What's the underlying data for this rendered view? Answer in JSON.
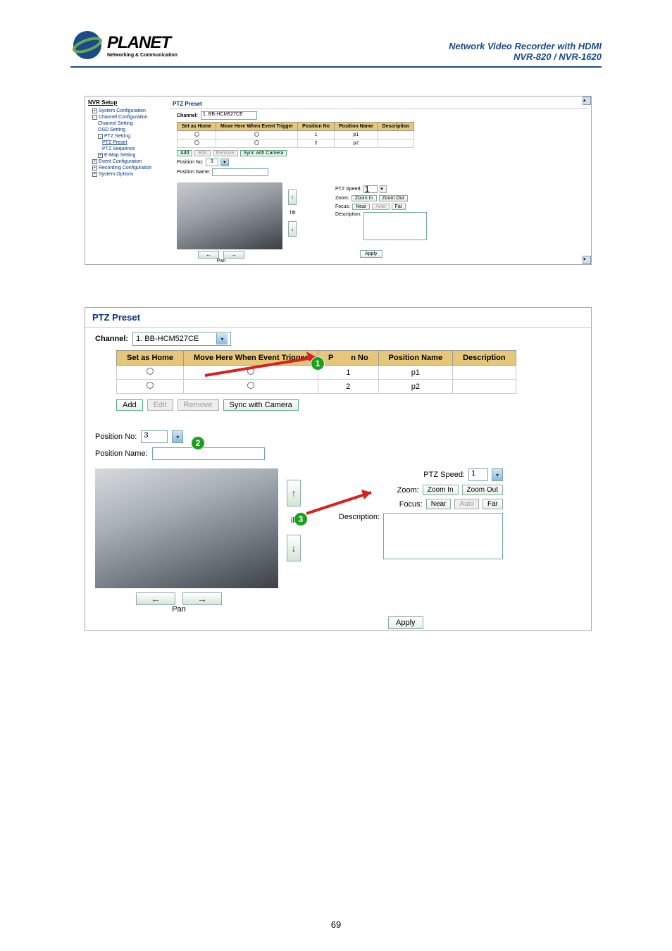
{
  "header": {
    "logo_main": "PLANET",
    "logo_sub": "Networking & Communication",
    "title": "Network Video Recorder with HDMI",
    "model": "NVR-820 / NVR-1620"
  },
  "screenshot1": {
    "nvr_setup": "NVR Setup",
    "nav": {
      "system_config": "System Configuration",
      "channel_config": "Channel Configuration",
      "channel_setting": "Channel Setting",
      "osd_setting": "OSD Setting",
      "ptz_setting": "PTZ Setting",
      "ptz_preset": "PTZ Preset",
      "ptz_sequence": "PTZ Sequence",
      "emap_setting": "E-Map Setting",
      "event_config": "Event Configuration",
      "recording_config": "Recording Configuration",
      "system_options": "System Options"
    },
    "panel_title": "PTZ Preset",
    "channel_label": "Channel:",
    "channel_value": "1. BB-HCM527CE",
    "table": {
      "set_as_home": "Set as Home",
      "move_here": "Move Here When Event Trigger",
      "position_no": "Position No",
      "position_name": "Position Name",
      "description": "Description",
      "rows": [
        {
          "no": "1",
          "name": "p1"
        },
        {
          "no": "2",
          "name": "p2"
        }
      ]
    },
    "btns": {
      "add": "Add",
      "edit": "Edit",
      "remove": "Remove",
      "sync": "Sync with Camera"
    },
    "position_no_label": "Position No:",
    "position_no_value": "3",
    "position_name_label": "Position Name:",
    "tilt": "Tilt",
    "pan": "Pan",
    "ptz_speed_label": "PTZ Speed:",
    "ptz_speed_value": "1",
    "zoom_label": "Zoom:",
    "zoom_in": "Zoom In",
    "zoom_out": "Zoom Out",
    "focus_label": "Focus:",
    "focus_near": "Near",
    "focus_auto": "Auto",
    "focus_far": "Far",
    "description_label": "Description:",
    "apply": "Apply"
  },
  "screenshot2": {
    "panel_title": "PTZ Preset",
    "channel_label": "Channel:",
    "channel_value": "1. BB-HCM527CE",
    "table": {
      "set_as_home": "Set as Home",
      "move_here": "Move Here When Event Trigger",
      "position_no_partial": "n No",
      "position_name": "Position Name",
      "description": "Description",
      "rows": [
        {
          "no": "1",
          "name": "p1"
        },
        {
          "no": "2",
          "name": "p2"
        }
      ]
    },
    "btns": {
      "add": "Add",
      "edit": "Edit",
      "remove": "Remove",
      "sync": "Sync with Camera"
    },
    "position_no_label": "Position No:",
    "position_no_value": "3",
    "position_name_label": "Position Name:",
    "tilt": "ilt",
    "pan": "Pan",
    "ptz_speed_label": "PTZ Speed:",
    "ptz_speed_value": "1",
    "zoom_label": "Zoom:",
    "zoom_in": "Zoom In",
    "zoom_out": "Zoom Out",
    "focus_label": "Focus:",
    "focus_near": "Near",
    "focus_auto": "Auto",
    "focus_far": "Far",
    "description_label": "Description:",
    "apply": "Apply",
    "callout_p": "P"
  },
  "page_number": "69"
}
